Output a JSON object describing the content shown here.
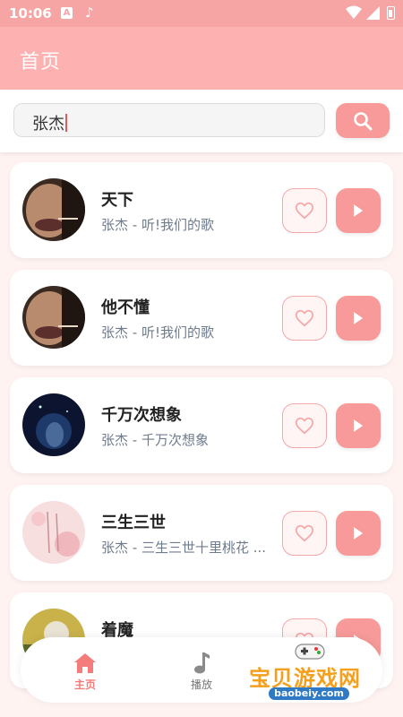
{
  "status_bar": {
    "time": "10:06",
    "a_icon_label": "A"
  },
  "header": {
    "title": "首页"
  },
  "search": {
    "value": "张杰"
  },
  "songs": [
    {
      "title": "天下",
      "subtitle": "张杰 - 听!我们的歌",
      "cover": "cover-dark-portrait"
    },
    {
      "title": "他不懂",
      "subtitle": "张杰 - 听!我们的歌",
      "cover": "cover-dark-portrait"
    },
    {
      "title": "千万次想象",
      "subtitle": "张杰 - 千万次想象",
      "cover": "cover-night-sky"
    },
    {
      "title": "三生三世",
      "subtitle": "张杰 - 三生三世十里桃花 ...",
      "cover": "cover-pink-calligraphy"
    },
    {
      "title": "着魔",
      "subtitle": "",
      "cover": "cover-outdoor"
    }
  ],
  "bottom_nav": {
    "home_label": "主页",
    "play_label": "播放",
    "home_icon": "home-icon",
    "play_icon": "music-note-icon"
  },
  "watermark": {
    "text": "宝贝游戏网",
    "url": "baobeiy.com"
  },
  "colors": {
    "accent": "#f79a99",
    "header": "#fdb2b1",
    "status": "#f6a5a4",
    "active_nav": "#f47c7a"
  }
}
